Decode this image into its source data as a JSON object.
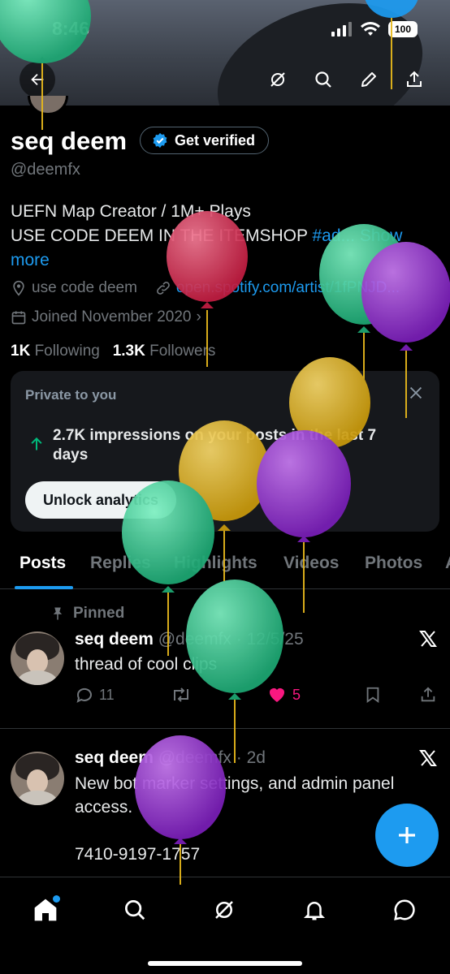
{
  "status_bar": {
    "time": "8:46",
    "battery": "100"
  },
  "profile": {
    "name": "seq deem",
    "verify_label": "Get verified",
    "handle": "@deemfx",
    "bio_line1": "UEFN Map Creator / 1M+ Plays",
    "bio_line2": "USE CODE DEEM IN THE ITEMSHOP",
    "bio_hashtag": "#ad...",
    "bio_show_more": "Show more",
    "location": "use code deem",
    "link": "open.spotify.com/artist/1fPNJD...",
    "joined": "Joined November 2020",
    "following_count": "1K",
    "following_label": "Following",
    "followers_count": "1.3K",
    "followers_label": "Followers"
  },
  "analytics_card": {
    "title": "Private to you",
    "text": "2.7K impressions on your posts in the last 7 days",
    "button": "Unlock analytics"
  },
  "tabs": [
    "Posts",
    "Replies",
    "Highlights",
    "Videos",
    "Photos",
    "A"
  ],
  "posts": [
    {
      "pinned_label": "Pinned",
      "author": "seq deem",
      "handle_date": "@deemfx · 12/5/25",
      "text": "thread of cool clips",
      "replies": "11",
      "likes": "5"
    },
    {
      "author": "seq deem",
      "handle_date": "@deemfx · 2d",
      "text_line1": "New bot marker settings, and admin panel",
      "text_line2": "access.",
      "text_line3": "7410-9197-1757"
    }
  ],
  "colors": {
    "accent": "#1d9bf0",
    "like": "#f91880",
    "balloon_green": "#2ecc8f",
    "balloon_purple": "#9b30d9",
    "balloon_yellow": "#e8b91c",
    "balloon_red": "#e23a5b"
  },
  "icons": [
    "back-arrow-icon",
    "grok-icon",
    "search-icon",
    "edit-icon",
    "share-icon",
    "verified-badge-icon",
    "location-icon",
    "link-icon",
    "calendar-icon",
    "close-icon",
    "trending-up-icon",
    "pin-icon",
    "x-logo-icon",
    "reply-icon",
    "repost-icon",
    "heart-icon",
    "bookmark-icon",
    "plus-icon",
    "home-icon",
    "notifications-icon",
    "messages-icon"
  ]
}
